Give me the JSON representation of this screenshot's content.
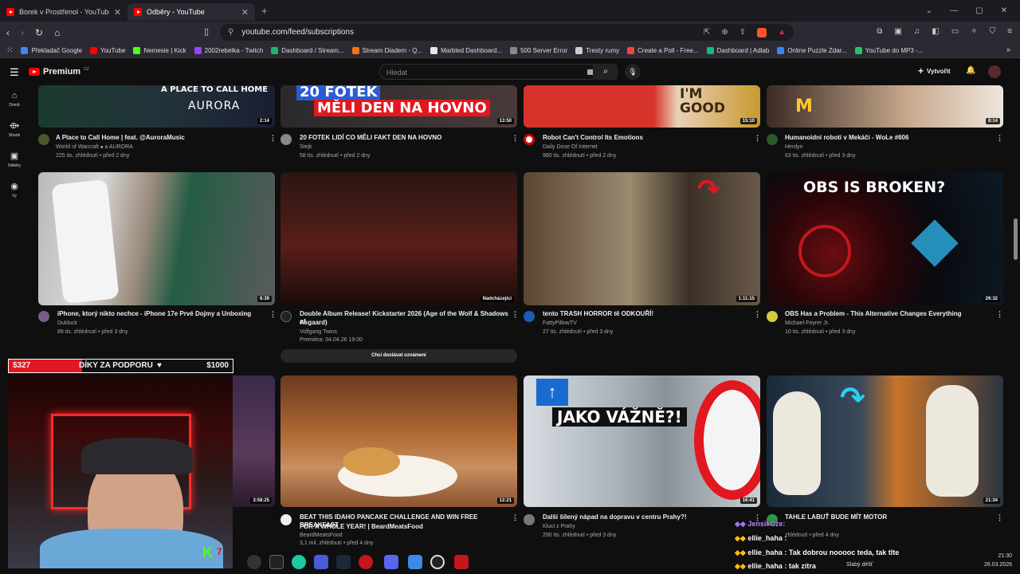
{
  "browser": {
    "tabs": [
      {
        "title": "Borek v Prostřenol - YouTube",
        "active": false
      },
      {
        "title": "Odběry - YouTube",
        "active": true
      }
    ],
    "url": "youtube.com/feed/subscriptions",
    "bookmarks": [
      {
        "label": "Překladač Google",
        "color": "#4285f4"
      },
      {
        "label": "YouTube",
        "color": "#ff0000"
      },
      {
        "label": "Nemesie | Kick",
        "color": "#53fc18"
      },
      {
        "label": "2002rebelka - Twitch",
        "color": "#9146ff"
      },
      {
        "label": "Dashboard / Stream...",
        "color": "#1fb36b"
      },
      {
        "label": "Stream Diadem - Q...",
        "color": "#f97316"
      },
      {
        "label": "Marbled Dashboard...",
        "color": "#e5e7eb"
      },
      {
        "label": "500 Server Error",
        "color": "#888888"
      },
      {
        "label": "Tresty rumy",
        "color": "#cccccc"
      },
      {
        "label": "Create a Poll - Free...",
        "color": "#ef4444"
      },
      {
        "label": "Dashboard | Adlab",
        "color": "#10b981"
      },
      {
        "label": "Online Puzzle Zdar...",
        "color": "#3b82f6"
      },
      {
        "label": "YouTube do MP3 -...",
        "color": "#22c55e"
      }
    ]
  },
  "youtube": {
    "logo": "Premium",
    "logo_sup": "CZ",
    "search_placeholder": "Hledat",
    "create_label": "Vytvořit",
    "sidebar": [
      {
        "label": "Domů",
        "icon": "home-icon"
      },
      {
        "label": "Shorts",
        "icon": "shorts-icon"
      },
      {
        "label": "Odběry",
        "icon": "subscriptions-icon"
      },
      {
        "label": "Vy",
        "icon": "you-icon"
      }
    ],
    "remind_label": "Chci dostávat oznámení",
    "videos": [
      {
        "title": "A Place to Call Home | feat. @AuroraMusic",
        "title2": "",
        "channel": "World of Warcraft ⦁ a AURORA",
        "meta": "225 tis. zhlédnutí • před 2 dny",
        "duration": "2:14",
        "thumb_text": "A PLACE TO CALL HOME"
      },
      {
        "title": "20 FOTEK LIDÍ CO MĚLI FAKT DEN NA HOVNO",
        "title2": "",
        "channel": "Stejk",
        "meta": "58 tis. zhlédnutí • před 2 dny",
        "duration": "13:50",
        "thumb_text": "20 FOTEK"
      },
      {
        "title": "Robot Can't Control Its Emotions",
        "title2": "",
        "channel": "Daily Dose Of Internet",
        "meta": "980 tis. zhlédnutí • před 2 dny",
        "duration": "15:10",
        "thumb_text": "I'M GOOD"
      },
      {
        "title": "Humanoidní roboti v Mekáči - WoLe #606",
        "title2": "",
        "channel": "Herdyn",
        "meta": "63 tis. zhlédnutí • před 3 dny",
        "duration": "8:14",
        "thumb_text": ""
      },
      {
        "title": "iPhone, ktorý nikto nechce - iPhone 17e Prvé Dojmy a Unboxing",
        "title2": "",
        "channel": "Duklock",
        "meta": "89 tis. zhlédnutí • před 3 dny",
        "duration": "8:39",
        "thumb_text": ""
      },
      {
        "title": "Double Album Release! Kickstarter 2026 (Age of the Wolf & Shadows of",
        "title2": "Asgaard)",
        "channel": "Volfgang Twins",
        "meta": "Premiéra: 04.04.26 19:00",
        "duration": "Nadcházející",
        "thumb_text": ""
      },
      {
        "title": "tento TRASH HORROR tě ODKOUŘÍ!",
        "title2": "",
        "channel": "FattyPillowTV",
        "meta": "27 tis. zhlédnutí • před 3 dny",
        "duration": "1:11:15",
        "thumb_text": ""
      },
      {
        "title": "OBS Has a Problem - This Alternative Changes Everything",
        "title2": "",
        "channel": "Michael Feyrer Jr.",
        "meta": "10 tis. zhlédnutí • před 3 dny",
        "duration": "26:32",
        "thumb_text": "OBS IS BROKEN?"
      },
      {
        "title": "",
        "title2": "",
        "channel": "",
        "meta": "",
        "duration": "3:58:25",
        "thumb_text": ""
      },
      {
        "title": "BEAT THIS IDAHO PANCAKE CHALLENGE AND WIN FREE BREAKFAST",
        "title2": "FOR A WHOLE YEAR! | BeardMeatsFood",
        "channel": "BeardMeatsFood",
        "meta": "3,1 mil. zhlédnutí • před 4 dny",
        "duration": "12:21",
        "thumb_text": ""
      },
      {
        "title": "Další šílený nápad na dopravu v centru Prahy?!",
        "title2": "",
        "channel": "Kluci z Prahy",
        "meta": "290 tis. zhlédnutí • před 3 dny",
        "duration": "16:41",
        "thumb_text": "JAKO VÁŽNĚ?!"
      },
      {
        "title": "TAHLE LABUŤ BUDE MÍT MOTOR",
        "title2": "",
        "channel": "",
        "meta": "zhlédnutí • před 4 dny",
        "duration": "21:34",
        "thumb_text": ""
      }
    ]
  },
  "stream_overlay": {
    "donation_current": "$327",
    "donation_label": "DÍKY ZA PODPORU",
    "donation_goal": "$1000",
    "donation_progress": 0.327,
    "chat": [
      {
        "user": "JensikCze",
        "text": ""
      },
      {
        "user": "ellie_haha",
        "text": ""
      },
      {
        "user": "ellie_haha",
        "text": "Tak dobrou nooooc teda, tak tlte"
      },
      {
        "user": "ellie_haha",
        "text": "tak zítra"
      }
    ]
  },
  "taskbar": {
    "weather": "Slabý déšť",
    "time": "21:30",
    "date": "26.03.2026"
  },
  "colors": {
    "accent": "#ff0000",
    "bg": "#0f0f0f"
  }
}
